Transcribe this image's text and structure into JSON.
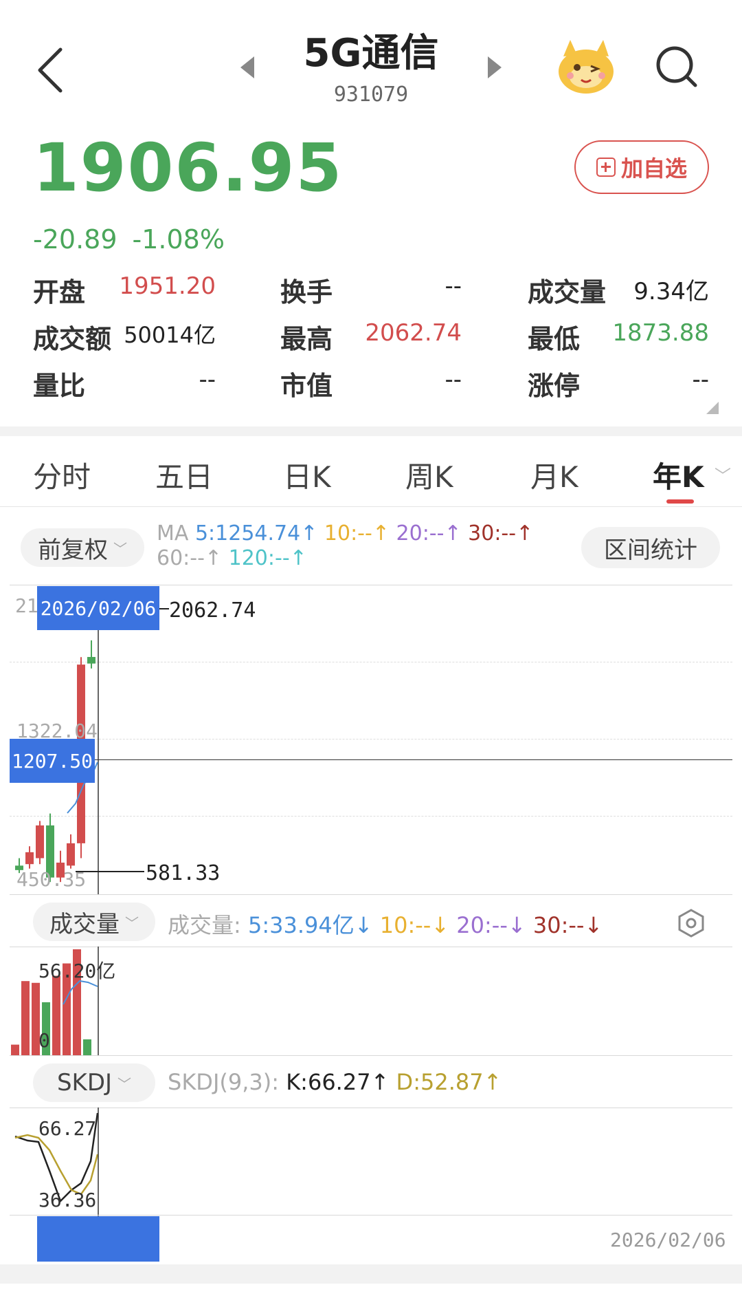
{
  "header": {
    "title": "5G通信",
    "code": "931079",
    "price": "1906.95",
    "change": "-20.89",
    "change_pct": "-1.08%",
    "watch_label": "加自选"
  },
  "stats": [
    {
      "label": "开盘",
      "value": "1951.20",
      "color": "red"
    },
    {
      "label": "换手",
      "value": "--",
      "color": "dark"
    },
    {
      "label": "成交量",
      "value": "9.34亿",
      "color": "dark"
    },
    {
      "label": "成交额",
      "value": "50014亿",
      "color": "dark"
    },
    {
      "label": "最高",
      "value": "2062.74",
      "color": "red"
    },
    {
      "label": "最低",
      "value": "1873.88",
      "color": "green"
    },
    {
      "label": "量比",
      "value": "--",
      "color": "dark"
    },
    {
      "label": "市值",
      "value": "--",
      "color": "dark"
    },
    {
      "label": "涨停",
      "value": "--",
      "color": "dark"
    }
  ],
  "tabs": [
    "分时",
    "五日",
    "日K",
    "周K",
    "月K",
    "年K"
  ],
  "active_tab": "年K",
  "ma": {
    "adjust_label": "前复权",
    "range_stats_label": "区间统计",
    "prefix": "MA",
    "ma5": "5:1254.74↑",
    "ma10": "10:--↑",
    "ma20": "20:--↑",
    "ma30": "30:--↑",
    "ma60": "60:--↑",
    "ma120": "120:--↑"
  },
  "kline": {
    "top_tick": "21",
    "selected_date": "2026/02/06",
    "high_label": "2062.74",
    "mid_tick": "1322.04",
    "crosshair_value": "1207.50",
    "low_tick": "450.35",
    "low_label": "581.33",
    "candles": [
      {
        "open": 550,
        "close": 520,
        "high": 600,
        "low": 500
      },
      {
        "open": 560,
        "close": 640,
        "high": 680,
        "low": 530
      },
      {
        "open": 600,
        "close": 820,
        "high": 850,
        "low": 560
      },
      {
        "open": 820,
        "close": 470,
        "high": 900,
        "low": 440
      },
      {
        "open": 470,
        "close": 570,
        "high": 650,
        "low": 440
      },
      {
        "open": 550,
        "close": 700,
        "high": 760,
        "low": 530
      },
      {
        "open": 700,
        "close": 1900,
        "high": 1950,
        "low": 600
      },
      {
        "open": 1951.2,
        "close": 1906.95,
        "high": 2062.74,
        "low": 1873.88
      }
    ],
    "range": [
      450,
      2150
    ]
  },
  "volume": {
    "selector_label": "成交量",
    "prefix": "成交量:",
    "v5": "5:33.94亿↓",
    "v10": "10:--↓",
    "v20": "20:--↓",
    "v30": "30:--↓",
    "max_tick": "56.20亿",
    "zero_tick": "0",
    "bars": [
      6,
      42,
      41,
      30,
      45,
      52,
      60,
      9
    ],
    "bar_colors": [
      "red",
      "red",
      "red",
      "green",
      "red",
      "red",
      "red",
      "green"
    ],
    "range": [
      0,
      60
    ]
  },
  "skdj": {
    "selector_label": "SKDJ",
    "prefix": "SKDJ(9,3):",
    "k": "K:66.27↑",
    "d": "D:52.87↑",
    "top_tick": "66.27",
    "bottom_tick": "36.36",
    "date_label": "2026/02/06"
  },
  "colors": {
    "up": "#d24d4d",
    "down": "#4aa65a",
    "accent": "#3b73e0",
    "ma5": "#4a90d9",
    "k_line": "#222222",
    "d_line": "#b8a030"
  }
}
